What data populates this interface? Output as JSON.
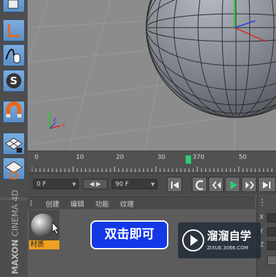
{
  "timeline": {
    "ruler_labels": [
      "0",
      "10",
      "20",
      "30",
      "370",
      "50"
    ],
    "playhead_marker": "370"
  },
  "playback": {
    "start_frame": "0 F",
    "end_frame": "90 F",
    "stepper_label": "◀ ▶"
  },
  "material_manager": {
    "menu": [
      "创建",
      "编辑",
      "功能",
      "纹理"
    ],
    "material_name": "材质"
  },
  "attributes": {
    "axes": [
      "X",
      "Y",
      "Z"
    ]
  },
  "brand": {
    "line1": "MAXON",
    "line2": "CINEMA 4D"
  },
  "tooltip": {
    "text": "双击即可"
  },
  "watermark": {
    "title": "溜溜自学",
    "url": "ZIXUE.3066.COM"
  },
  "icons": {
    "toolbar": [
      "cube-icon",
      "axis-icon",
      "spline-mouse-icon",
      "snap-s-icon",
      "magnet-icon",
      "grid-lock-icon",
      "grid-cycle-icon"
    ],
    "playback": [
      "go-to-start-icon",
      "record-icon",
      "prev-key-icon",
      "play-icon",
      "next-key-icon",
      "go-to-end-icon"
    ]
  },
  "colors": {
    "accent_blue": "#5a8cc4",
    "playhead_green": "#2ecc71",
    "material_label_orange": "#f0a020",
    "tooltip_blue": "#1438e8"
  }
}
